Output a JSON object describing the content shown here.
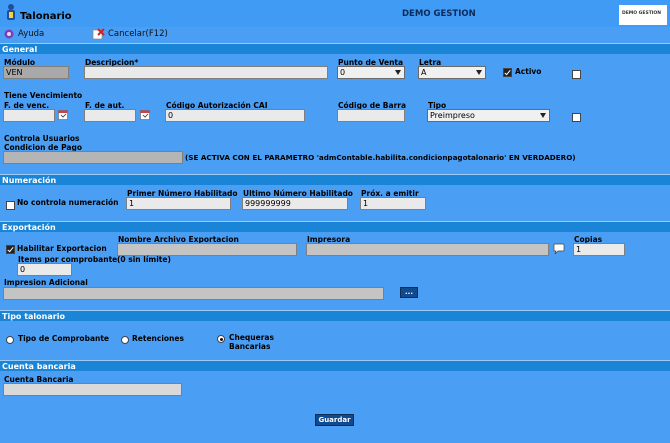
{
  "header": {
    "title": "Talonario",
    "center_title": "DEMO GESTION",
    "logo_text": "DEMO GESTION"
  },
  "toolbar": {
    "help_label": "Ayuda",
    "cancel_label": "Cancelar(F12)"
  },
  "sections": {
    "general": "General",
    "numeracion": "Numeración",
    "exportacion": "Exportación",
    "tipo_talonario": "Tipo talonario",
    "cuenta_bancaria": "Cuenta bancaria"
  },
  "general": {
    "modulo_label": "Módulo",
    "modulo_value": "VEN",
    "descripcion_label": "Descripcion*",
    "descripcion_value": "",
    "punto_venta_label": "Punto de Venta",
    "punto_venta_value": "0",
    "letra_label": "Letra",
    "letra_value": "A",
    "activo_label": "Activo",
    "tiene_vencimiento_label": "Tiene Vencimiento",
    "f_venc_label": "F. de venc.",
    "f_aut_label": "F. de aut.",
    "cai_label": "Código Autorización CAI",
    "cai_value": "0",
    "codigo_barra_label": "Código de Barra",
    "tipo_label": "Tipo",
    "tipo_value": "Preimpreso",
    "controla_usuarios_label": "Controla Usuarios",
    "condicion_pago_label": "Condicion de Pago",
    "condicion_pago_note": "(SE ACTIVA CON EL PARAMETRO 'admContable.habilita.condicionpagotalonario' EN VERDADERO)"
  },
  "numeracion": {
    "no_controla_label": "No controla numeración",
    "primer_label": "Primer Número Habilitado",
    "primer_value": "1",
    "ultimo_label": "Ultimo Número Habilitado",
    "ultimo_value": "999999999",
    "prox_label": "Próx. a emitir",
    "prox_value": "1"
  },
  "exportacion": {
    "habilitar_label": "Habilitar Exportacion",
    "nombre_archivo_label": "Nombre Archivo Exportacion",
    "impresora_label": "Impresora",
    "copias_label": "Copias",
    "copias_value": "1",
    "items_label": "Items por comprobante",
    "items_hint": "(0 sin límite)",
    "items_value": "0",
    "impresion_adicional_label": "Impresion Adicional",
    "ellipsis_label": "..."
  },
  "tipo_talonario": {
    "options": [
      "Tipo de Comprobante",
      "Retenciones",
      "Chequeras Bancarias"
    ],
    "selected": "Chequeras Bancarias"
  },
  "cuenta_bancaria": {
    "label": "Cuenta Bancaria",
    "value": ""
  },
  "actions": {
    "guardar_label": "Guardar"
  }
}
